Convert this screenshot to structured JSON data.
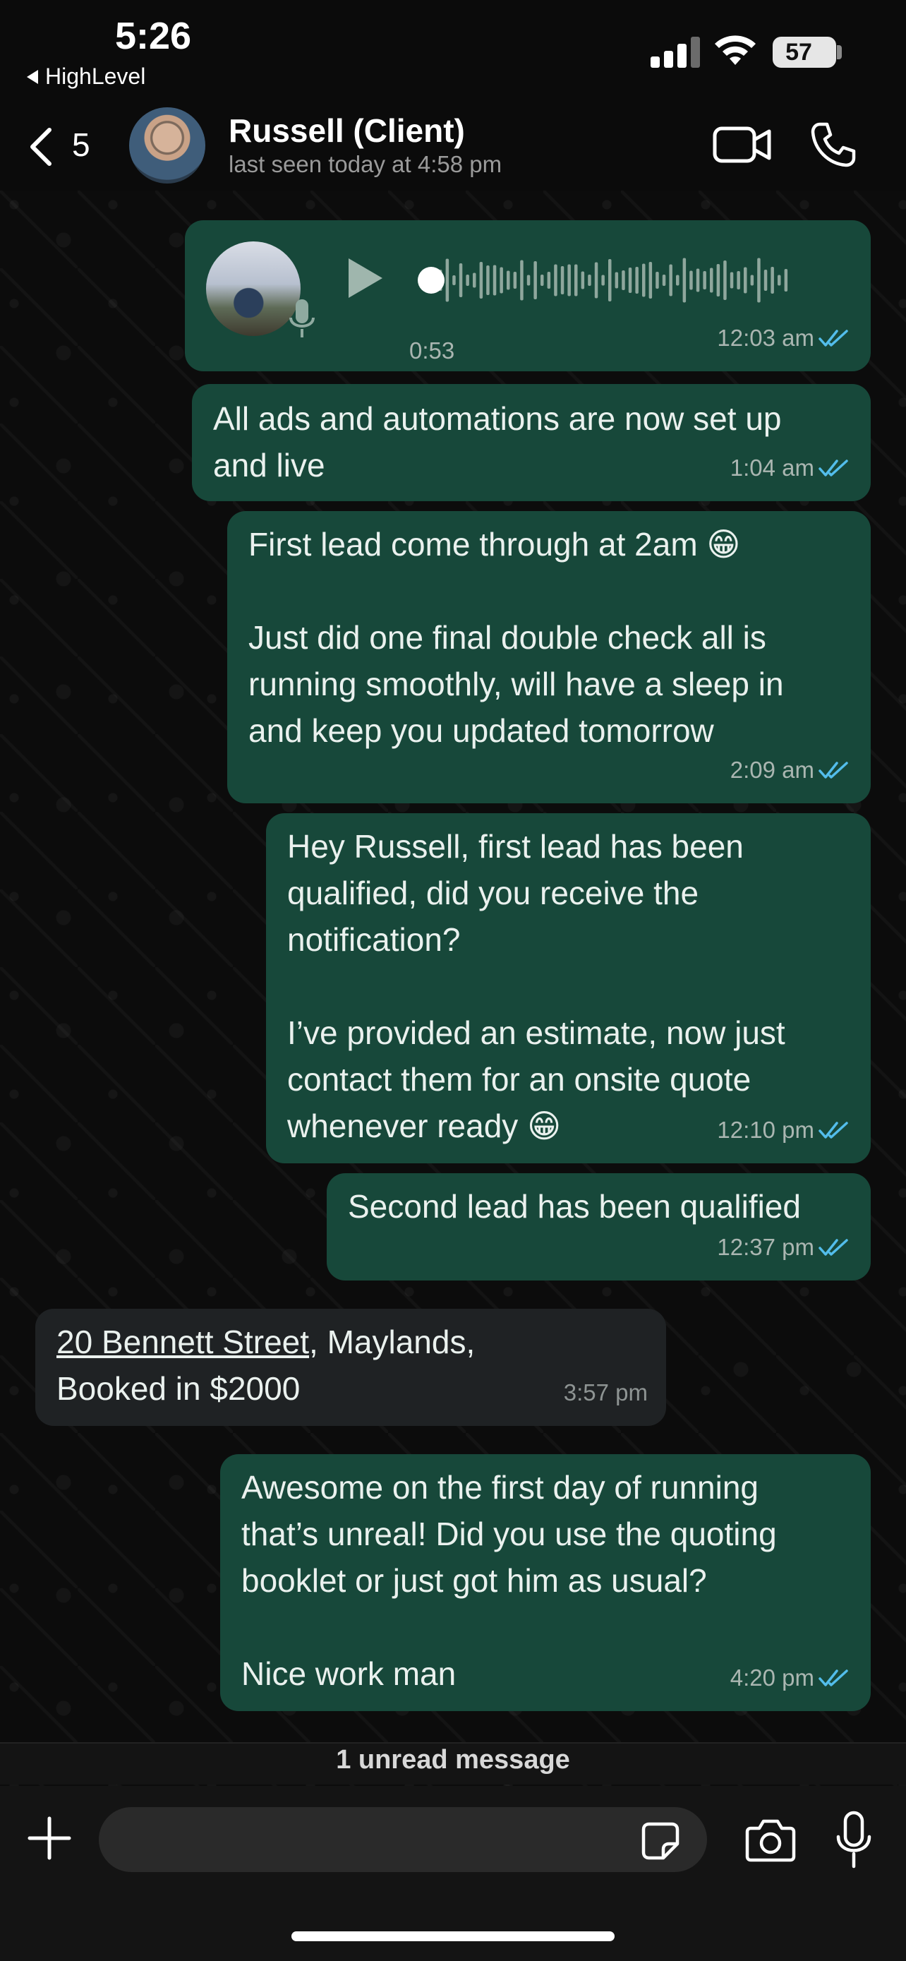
{
  "status_bar": {
    "time": "5:26",
    "back_app": "HighLevel",
    "battery": "57"
  },
  "header": {
    "unread_count": "5",
    "contact_name": "Russell (Client)",
    "last_seen": "last seen today at 4:58 pm"
  },
  "messages": [
    {
      "type": "voice",
      "duration": "0:53",
      "time": "12:03 am",
      "direction": "out"
    },
    {
      "type": "text",
      "text": "All ads and automations are now set up\nand live",
      "time": "1:04 am",
      "direction": "out"
    },
    {
      "type": "text",
      "text": "First lead come through at 2am 😁\n\nJust did one final double check all is\nrunning smoothly, will have a sleep in\nand keep you updated tomorrow",
      "time": "2:09 am",
      "direction": "out"
    },
    {
      "type": "text",
      "text": "Hey Russell, first lead has been\nqualified, did you receive the\nnotification?\n\nI’ve provided an estimate, now just\ncontact them for an onsite quote\nwhenever ready 😁",
      "time": "12:10 pm",
      "direction": "out"
    },
    {
      "type": "text",
      "text": "Second lead has been qualified",
      "time": "12:37 pm",
      "direction": "out"
    },
    {
      "type": "text",
      "link": "20 Bennett Street",
      "text_after_link": ", Maylands,",
      "text_line2": "Booked in $2000",
      "time": "3:57 pm",
      "direction": "in"
    },
    {
      "type": "text",
      "text": "Awesome on the first day of running\nthat’s unreal! Did you use the quoting\nbooklet or just got him as usual?\n\nNice work man",
      "time": "4:20 pm",
      "direction": "out"
    }
  ],
  "unread_banner": "1 unread message",
  "input": {
    "placeholder": ""
  },
  "colors": {
    "outgoing_bubble": "#17483a",
    "incoming_bubble": "#1f2224",
    "read_tick": "#53bdeb"
  }
}
